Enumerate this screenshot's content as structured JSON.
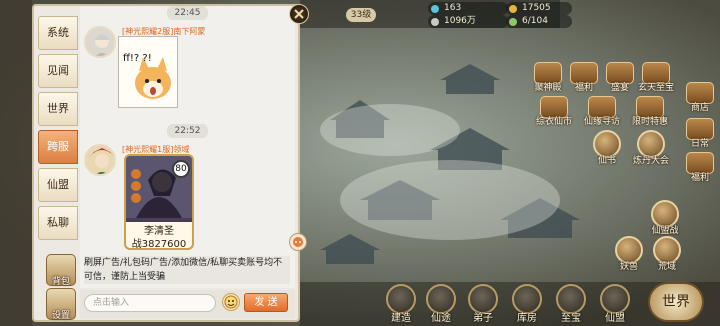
{
  "chat": {
    "tabs": [
      "系统",
      "见闻",
      "世界",
      "跨服",
      "仙盟",
      "私聊"
    ],
    "active_tab": "跨服",
    "side_buttons": [
      "背包",
      "设置"
    ],
    "messages": [
      {
        "timestamp": "22:45",
        "sender": "[神光熙耀2服]南下阿蒙",
        "type": "sticker",
        "sticker_text": "ff!? ?!"
      },
      {
        "timestamp": "22:52",
        "sender": "[神光熙耀1服]领域",
        "type": "hero-card",
        "card": {
          "level": "80",
          "name": "李清圣",
          "power": "战3827600"
        }
      }
    ],
    "notice": "刷屏广告/礼包码广告/添加微信/私聊买卖账号均不可信，谨防上当受骗",
    "input_placeholder": "点击输入",
    "send_label": "发 送"
  },
  "hud": {
    "level_badge": "33级",
    "resources": [
      "163",
      "17505",
      "1096万",
      "6/104"
    ]
  },
  "game_menu": {
    "top_row": [
      "聚神殿",
      "福利",
      "盛宴",
      "玄天至宝"
    ],
    "shop": "商店",
    "second_row": [
      "综衣仙市",
      "仙缘寻访",
      "限时特惠"
    ],
    "right_col": [
      "日常",
      "福利"
    ],
    "third_row": [
      "仙书",
      "炼丹大会"
    ],
    "sect_war": "仙盟战",
    "bottom_icons": [
      "妖兽",
      "荒域"
    ],
    "bottom_nav": [
      "建造",
      "仙途",
      "弟子",
      "库房",
      "至宝",
      "仙盟"
    ],
    "world_button": "世界"
  },
  "colors": {
    "accent": "#e0661d",
    "active_tab": "#d97f43",
    "panel_bg": "#ece9e2"
  }
}
